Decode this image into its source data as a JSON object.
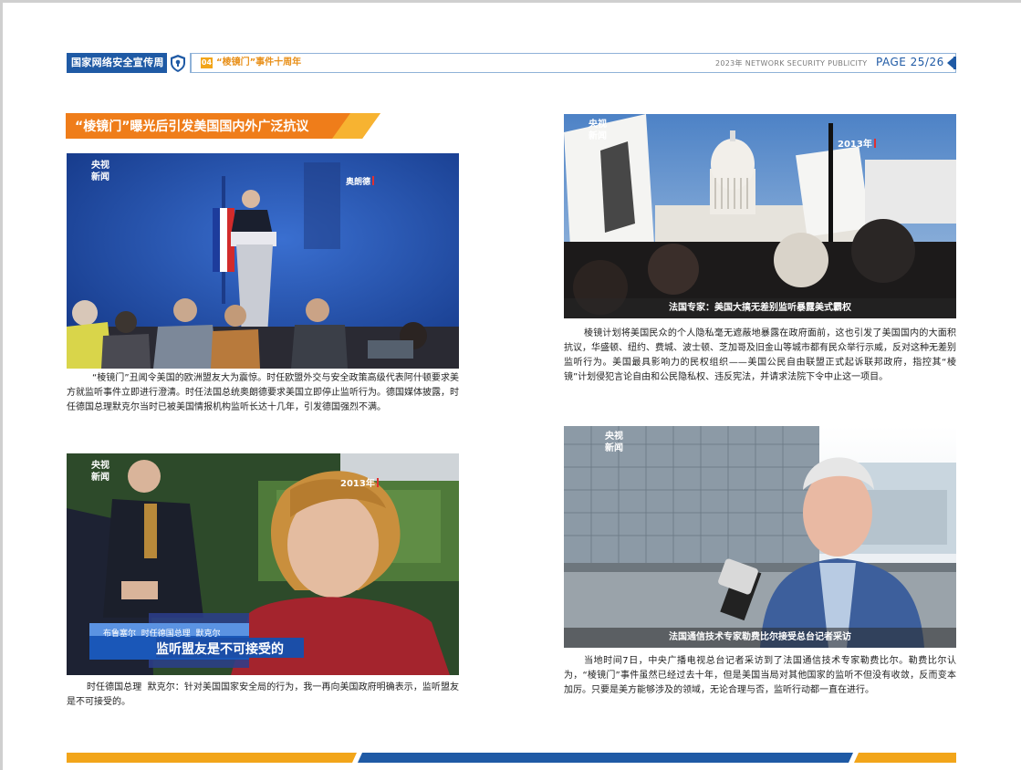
{
  "header": {
    "badge": "国家网络安全宣传周",
    "section_no": "04",
    "topic": "“棱镜门”事件十周年",
    "year_label": "2023年  NETWORK SECURITY PUBLICITY",
    "page_label": "PAGE  25/26"
  },
  "section_title": "“棱镜门”曝光后引发美国国内外广泛抗议",
  "photo_logo": {
    "line1": "央视",
    "line2": "新闻"
  },
  "left": {
    "photo1": {
      "name_tag": "奥朗德"
    },
    "paragraph1": "“棱镜门”丑闻令美国的欧洲盟友大为震惊。时任欧盟外交与安全政策高级代表阿什顿要求美方就监听事件立即进行澄清。时任法国总统奥朗德要求美国立即停止监听行为。德国媒体披露，时任德国总理默克尔当时已被美国情报机构监听长达十几年，引发德国强烈不满。",
    "photo2": {
      "year_tag": "2013年",
      "lower_third_small": "布鲁塞尔  时任德国总理  默克尔",
      "lower_third_main": "监听盟友是不可接受的"
    },
    "paragraph2": "时任德国总理  默克尔：针对美国国家安全局的行为，我一再向美国政府明确表示，监听盟友是不可接受的。"
  },
  "right": {
    "photo1": {
      "year_tag": "2013年",
      "caption": "法国专家：美国大搞无差别监听暴露美式霸权"
    },
    "paragraph1": "棱镜计划将美国民众的个人隐私毫无遮蔽地暴露在政府面前，这也引发了美国国内的大面积抗议，华盛顿、纽约、费城、波士顿、芝加哥及旧金山等城市都有民众举行示威，反对这种无差别监听行为。美国最具影响力的民权组织——美国公民自由联盟正式起诉联邦政府，指控其“棱镜”计划侵犯言论自由和公民隐私权、违反宪法，并请求法院下令中止这一项目。",
    "photo2": {
      "caption": "法国通信技术专家勒费比尔接受总台记者采访"
    },
    "paragraph2": "当地时间7日，中央广播电视总台记者采访到了法国通信技术专家勒费比尔。勒费比尔认为，“棱镜门”事件虽然已经过去十年，但是美国当局对其他国家的监听不但没有收敛，反而变本加厉。只要是美方能够涉及的领域，无论合理与否，监听行动都一直在进行。"
  },
  "colors": {
    "brand_blue": "#1f5aa5",
    "accent_orange": "#f2a51a",
    "title_orange": "#ef7d1a"
  }
}
